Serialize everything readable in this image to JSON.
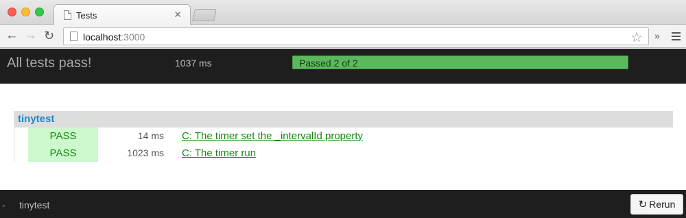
{
  "browser": {
    "tab_title": "Tests",
    "url_host": "localhost",
    "url_port": ":3000"
  },
  "header": {
    "title": "All tests pass!",
    "duration": "1037 ms",
    "progress_label": "Passed 2 of 2",
    "progress_fraction": 1.0,
    "progress_color": "#5cb85c"
  },
  "group": {
    "name": "tinytest",
    "tests": [
      {
        "status": "PASS",
        "duration": "14 ms",
        "name": "C: The timer set the _intervalId property"
      },
      {
        "status": "PASS",
        "duration": "1023 ms",
        "name": "C: The timer run"
      }
    ]
  },
  "footer": {
    "dash": "-",
    "group_name": "tinytest",
    "rerun_label": "Rerun"
  }
}
